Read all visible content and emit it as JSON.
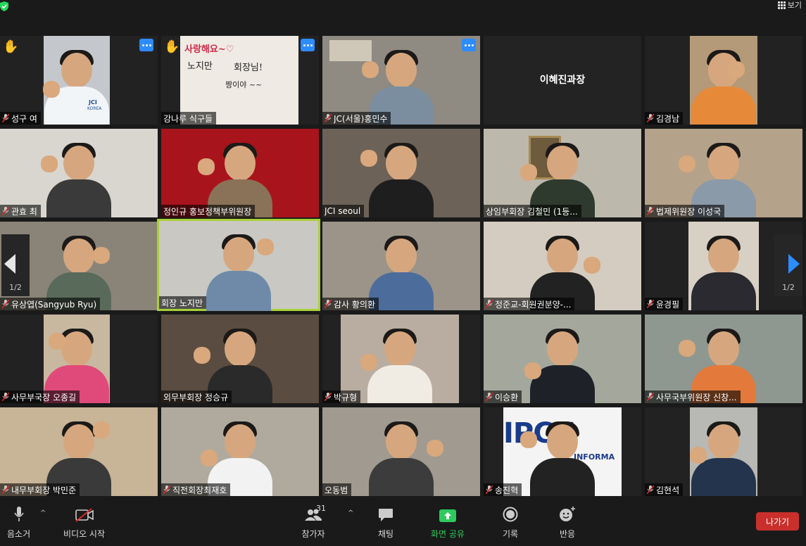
{
  "top": {
    "view_label": "보기"
  },
  "pager": {
    "left_label": "1/2",
    "right_label": "1/2"
  },
  "tiles": [
    {
      "name": "성구 여"
    },
    {
      "name": "강나루 식구들"
    },
    {
      "name": "JC(서울)홍민수"
    },
    {
      "name": "김경남"
    },
    {
      "name": "관효 최"
    },
    {
      "name": "정인규 홍보정책부위원장"
    },
    {
      "name": "JCI seoul"
    },
    {
      "name": "상임부회장 김철민 (1등..."
    },
    {
      "name": "법제위원장 이성국"
    },
    {
      "name": "유상엽(Sangyub Ryu)"
    },
    {
      "name": "회장 노지만"
    },
    {
      "name": "감사 황의환"
    },
    {
      "name": "정준교-회원권분양-..."
    },
    {
      "name": "윤경필"
    },
    {
      "name": "사무부국장 오종길"
    },
    {
      "name": "외무부회장 정승규"
    },
    {
      "name": "박규형"
    },
    {
      "name": "이승환"
    },
    {
      "name": "사무국부위원장 신창..."
    },
    {
      "name": "내무부회장 박민준"
    },
    {
      "name": "직전회장최재호"
    },
    {
      "name": "오동범"
    },
    {
      "name": "송진혁"
    },
    {
      "name": "김현석"
    }
  ],
  "placeholder": {
    "name": "이혜진과장"
  },
  "sign": {
    "line1": "사랑해요~♡",
    "line2": "노지만",
    "line3": "회장님!",
    "line4": "짱이야 ~~"
  },
  "logo": {
    "text1": "JCI",
    "text2": "KOREA",
    "text3": "IPCU",
    "text4": "INFORMA"
  },
  "toolbar": {
    "mute": "음소거",
    "video": "비디오 시작",
    "participants": "참가자",
    "participants_count": "31",
    "chat": "채팅",
    "share": "화면 공유",
    "record": "기록",
    "reactions": "반응",
    "leave": "나가기"
  },
  "colors": {
    "share_green": "#2dca5c",
    "leave_red": "#c9302c",
    "active_border": "#a9d037",
    "menu_blue": "#2d8cff"
  }
}
